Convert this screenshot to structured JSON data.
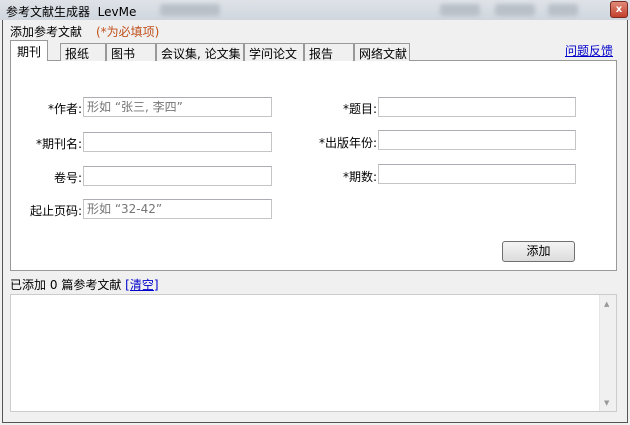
{
  "window": {
    "title": "参考文献生成器",
    "app_name": "LevMe",
    "close": "x"
  },
  "header": {
    "label": "添加参考文献",
    "required_note": "(*为必填项)",
    "feedback_link": "问题反馈"
  },
  "tabs": [
    {
      "label": "期刊",
      "active": true
    },
    {
      "label": "报纸"
    },
    {
      "label": "图书"
    },
    {
      "label": "会议集, 论文集"
    },
    {
      "label": "学问论文"
    },
    {
      "label": "报告"
    },
    {
      "label": "网络文献"
    }
  ],
  "form": {
    "author": {
      "label": "*作者:",
      "placeholder": "形如 “张三, 李四”"
    },
    "title": {
      "label": "*题目:",
      "value": ""
    },
    "journal": {
      "label": "*期刊名:",
      "value": ""
    },
    "year": {
      "label": "*出版年份:",
      "value": ""
    },
    "volume": {
      "label": "卷号:",
      "value": ""
    },
    "issue": {
      "label": "*期数:",
      "value": ""
    },
    "pages": {
      "label": "起止页码:",
      "placeholder": "形如 “32-42”"
    },
    "add_button": "添加"
  },
  "status": {
    "prefix": "已添加",
    "count": "0",
    "suffix": "篇参考文献",
    "clear_link": "[清空]"
  },
  "colors": {
    "required": "#c0501a",
    "link": "#0000cc"
  }
}
